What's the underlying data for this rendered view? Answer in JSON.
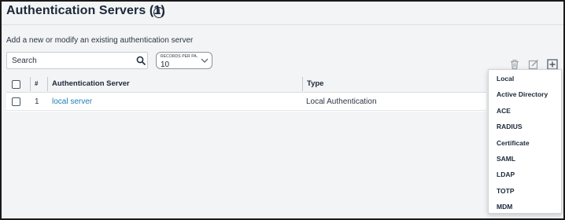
{
  "header": {
    "title": "Authentication Servers (1)",
    "info_icon": "info-circle-icon"
  },
  "subtitle": "Add a new or modify an existing authentication server",
  "search": {
    "placeholder": "Search",
    "icon": "search-icon"
  },
  "records_per_page": {
    "label": "RECORDS PER PA...",
    "value": "10"
  },
  "toolbar": {
    "icons": [
      "trash-icon",
      "edit-icon",
      "add-icon"
    ]
  },
  "table": {
    "columns": [
      "#",
      "Authentication Server",
      "Type"
    ],
    "rows": [
      {
        "index": "1",
        "name": "local server",
        "type": "Local Authentication"
      }
    ]
  },
  "add_menu": {
    "items": [
      "Local",
      "Active Directory",
      "ACE",
      "RADIUS",
      "Certificate",
      "SAML",
      "LDAP",
      "TOTP",
      "MDM"
    ]
  },
  "colors": {
    "page_bg": "#f3f4f6",
    "link": "#1d7fb8",
    "text": "#1b2838"
  }
}
